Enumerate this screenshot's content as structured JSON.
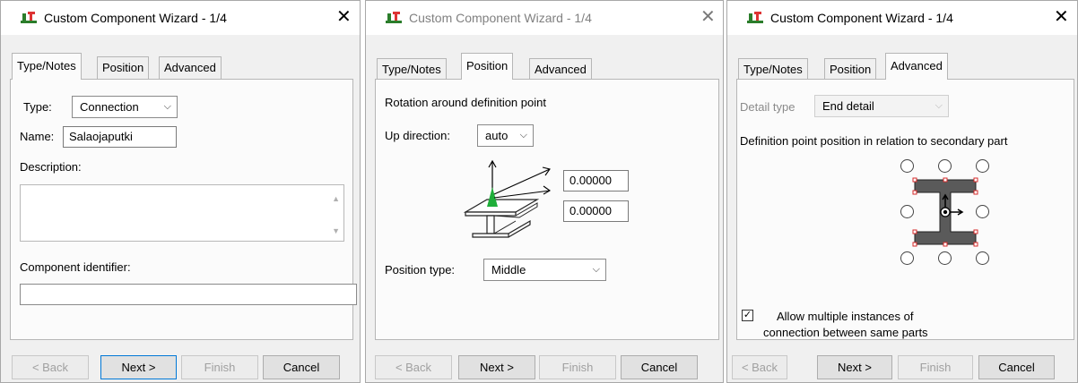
{
  "windows": [
    {
      "title": "Custom Component Wizard - 1/4",
      "close_glyph": "✕",
      "active_tab": "Type/Notes",
      "tabs": [
        "Type/Notes",
        "Position",
        "Advanced"
      ],
      "type_label": "Type:",
      "type_value": "Connection",
      "name_label": "Name:",
      "name_value": "Salaojaputki",
      "description_label": "Description:",
      "description_value": "",
      "component_identifier_label": "Component identifier:",
      "component_identifier_value": "",
      "buttons": {
        "back": "< Back",
        "next": "Next >",
        "finish": "Finish",
        "cancel": "Cancel"
      }
    },
    {
      "title": "Custom Component Wizard - 1/4",
      "close_glyph": "✕",
      "active_tab": "Position",
      "tabs": [
        "Type/Notes",
        "Position",
        "Advanced"
      ],
      "rotation_label": "Rotation around definition point",
      "up_direction_label": "Up direction:",
      "up_direction_value": "auto",
      "offset_1": "0.00000",
      "offset_2": "0.00000",
      "position_type_label": "Position type:",
      "position_type_value": "Middle",
      "buttons": {
        "back": "< Back",
        "next": "Next >",
        "finish": "Finish",
        "cancel": "Cancel"
      }
    },
    {
      "title": "Custom Component Wizard - 1/4",
      "close_glyph": "✕",
      "active_tab": "Advanced",
      "tabs": [
        "Type/Notes",
        "Position",
        "Advanced"
      ],
      "detail_type_label": "Detail type",
      "detail_type_value": "End detail",
      "definition_point_label": "Definition point position in relation to secondary part",
      "allow_multiple_checked": true,
      "allow_multiple_label_line1": "Allow multiple instances of",
      "allow_multiple_label_line2": "connection between same parts",
      "buttons": {
        "back": "< Back",
        "next": "Next >",
        "finish": "Finish",
        "cancel": "Cancel"
      }
    }
  ],
  "icons": {
    "chevron": "⌵",
    "checkmark": "✓",
    "scroll_up": "▲",
    "scroll_down": "▼"
  },
  "colors": {
    "accent_blue": "#0078d7",
    "profile_fill": "#5a5a5a",
    "marker_red": "#d62a2a",
    "highlight_green": "#1fae3a"
  }
}
